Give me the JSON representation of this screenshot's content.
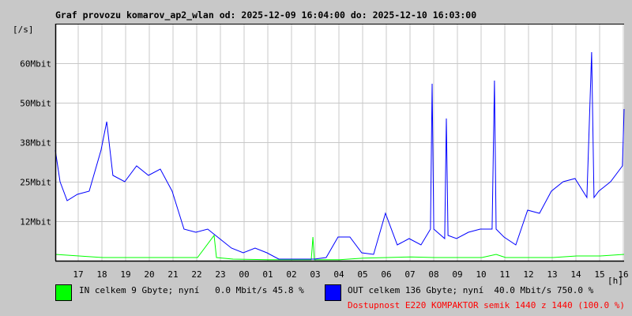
{
  "chart_data": {
    "type": "line",
    "title": "Graf provozu komarov_ap2_wlan od: 2025-12-09 16:04:00 do: 2025-12-10 16:03:00",
    "ylabel": "[/s]",
    "xlabel": "[h]",
    "ylim": [
      0,
      75
    ],
    "xlim": [
      0,
      24
    ],
    "grid": true,
    "y_ticks": [
      {
        "value": 12.5,
        "label": "12Mbit"
      },
      {
        "value": 25,
        "label": "25Mbit"
      },
      {
        "value": 37.5,
        "label": "38Mbit"
      },
      {
        "value": 50,
        "label": "50Mbit"
      },
      {
        "value": 62.5,
        "label": "60Mbit"
      }
    ],
    "x_ticks": [
      "17",
      "18",
      "19",
      "20",
      "21",
      "22",
      "23",
      "00",
      "01",
      "02",
      "03",
      "04",
      "05",
      "06",
      "07",
      "08",
      "09",
      "10",
      "11",
      "12",
      "13",
      "14",
      "15",
      "16"
    ],
    "series": [
      {
        "name": "OUT",
        "color": "#0000ff",
        "points": [
          [
            0,
            35
          ],
          [
            0.2,
            25
          ],
          [
            0.5,
            19
          ],
          [
            0.93,
            21
          ],
          [
            1.43,
            22
          ],
          [
            1.93,
            35
          ],
          [
            2.17,
            44
          ],
          [
            2.43,
            27
          ],
          [
            2.93,
            25
          ],
          [
            3.43,
            30
          ],
          [
            3.93,
            27
          ],
          [
            4.43,
            29
          ],
          [
            4.93,
            22
          ],
          [
            5.43,
            10
          ],
          [
            5.93,
            9
          ],
          [
            6.43,
            10
          ],
          [
            6.93,
            7
          ],
          [
            7.43,
            4
          ],
          [
            7.93,
            2.5
          ],
          [
            8.43,
            4
          ],
          [
            8.93,
            2.5
          ],
          [
            9.43,
            0.5
          ],
          [
            9.93,
            0.5
          ],
          [
            10.43,
            0.5
          ],
          [
            10.93,
            0.5
          ],
          [
            11.43,
            1
          ],
          [
            11.93,
            7.5
          ],
          [
            12.43,
            7.5
          ],
          [
            12.93,
            2.5
          ],
          [
            13.43,
            2
          ],
          [
            13.93,
            15
          ],
          [
            14.43,
            5
          ],
          [
            14.93,
            7
          ],
          [
            15.43,
            5
          ],
          [
            15.83,
            10
          ],
          [
            15.9,
            56
          ],
          [
            15.97,
            10
          ],
          [
            16.43,
            7
          ],
          [
            16.5,
            45
          ],
          [
            16.57,
            8
          ],
          [
            16.93,
            7
          ],
          [
            17.43,
            9
          ],
          [
            17.93,
            10
          ],
          [
            18.43,
            10
          ],
          [
            18.53,
            57
          ],
          [
            18.6,
            10
          ],
          [
            18.93,
            7.5
          ],
          [
            19.43,
            5
          ],
          [
            19.93,
            16
          ],
          [
            20.43,
            15
          ],
          [
            20.93,
            22
          ],
          [
            21.43,
            25
          ],
          [
            21.93,
            26
          ],
          [
            22.43,
            20
          ],
          [
            22.63,
            66
          ],
          [
            22.73,
            20
          ],
          [
            22.93,
            22
          ],
          [
            23.43,
            25
          ],
          [
            23.93,
            30
          ],
          [
            24,
            48
          ]
        ]
      },
      {
        "name": "IN",
        "color": "#00ff00",
        "points": [
          [
            0,
            2
          ],
          [
            1,
            1.5
          ],
          [
            2,
            1
          ],
          [
            3,
            1
          ],
          [
            4,
            1
          ],
          [
            5,
            1
          ],
          [
            6,
            1
          ],
          [
            6.7,
            8
          ],
          [
            6.8,
            1
          ],
          [
            7.5,
            0.5
          ],
          [
            9,
            0.3
          ],
          [
            10.8,
            0.3
          ],
          [
            10.87,
            7.5
          ],
          [
            10.93,
            0.3
          ],
          [
            12,
            0.3
          ],
          [
            13,
            0.8
          ],
          [
            14,
            1
          ],
          [
            15,
            1.2
          ],
          [
            16,
            1
          ],
          [
            17,
            1
          ],
          [
            18,
            1
          ],
          [
            18.6,
            2
          ],
          [
            19,
            1
          ],
          [
            20,
            1
          ],
          [
            21,
            1
          ],
          [
            22,
            1.5
          ],
          [
            23,
            1.5
          ],
          [
            24,
            2
          ]
        ]
      }
    ]
  },
  "legend": {
    "in_text": "IN celkem 9 Gbyte; nyní   0.0 Mbit/s 45.8 %",
    "out_text": "OUT celkem 136 Gbyte; nyní  40.0 Mbit/s 750.0 %",
    "availability": "Dostupnost E220 KOMPAKTOR semik 1440 z 1440 (100.0 %)",
    "in_color": "#00ff00",
    "out_color": "#0000ff",
    "availability_color": "#ff0000"
  }
}
